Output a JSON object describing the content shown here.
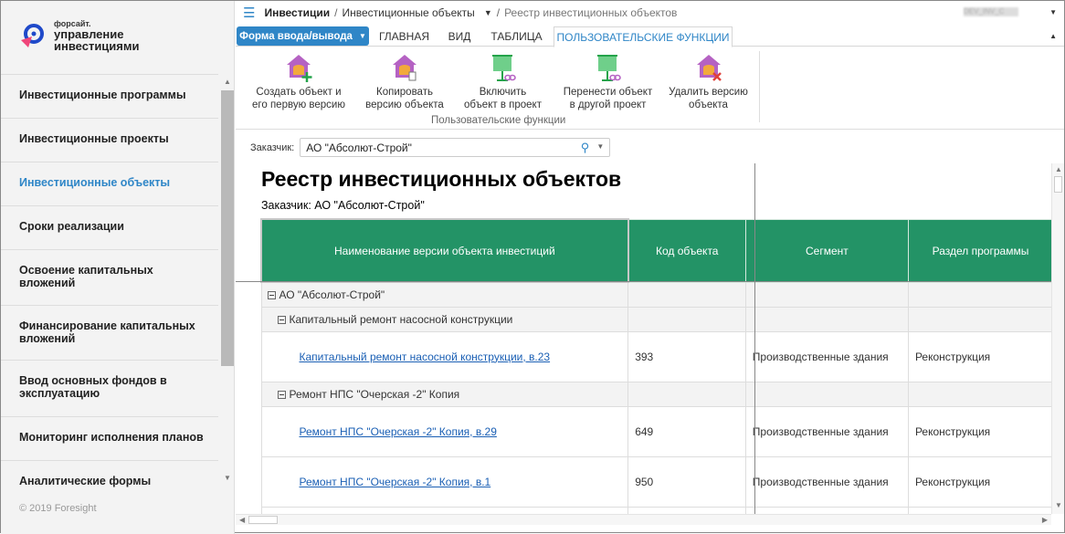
{
  "brand": {
    "company": "форсайт.",
    "product_line1": "управление",
    "product_line2": "инвестициями"
  },
  "sidebar": {
    "items": [
      {
        "label": "Инвестиционные программы"
      },
      {
        "label": "Инвестиционные проекты"
      },
      {
        "label": "Инвестиционные объекты",
        "active": true
      },
      {
        "label": "Сроки реализации"
      },
      {
        "label": "Освоение капитальных вложений"
      },
      {
        "label": "Финансирование капитальных вложений"
      },
      {
        "label": "Ввод основных фондов в эксплуатацию"
      },
      {
        "label": "Мониторинг исполнения планов"
      },
      {
        "label": "Аналитические формы"
      }
    ],
    "footer": "© 2019 Foresight"
  },
  "breadcrumb": {
    "root": "Инвестиции",
    "section": "Инвестиционные объекты",
    "page": "Реестр инвестиционных объектов"
  },
  "user": "DEV_INV_C",
  "tabs": {
    "form_button": "Форма ввода/вывода",
    "items": [
      "ГЛАВНАЯ",
      "ВИД",
      "ТАБЛИЦА",
      "ПОЛЬЗОВАТЕЛЬСКИЕ ФУНКЦИИ"
    ]
  },
  "ribbon": {
    "group_label": "Пользовательские функции",
    "buttons": [
      {
        "l1": "Создать объект и",
        "l2": "его первую версию"
      },
      {
        "l1": "Копировать",
        "l2": "версию объекта"
      },
      {
        "l1": "Включить",
        "l2": "объект в проект"
      },
      {
        "l1": "Перенести объект",
        "l2": "в другой проект"
      },
      {
        "l1": "Удалить версию",
        "l2": "объекта"
      }
    ]
  },
  "filter": {
    "label": "Заказчик:",
    "value": "АО \"Абсолют-Строй\""
  },
  "report": {
    "title": "Реестр инвестиционных объектов",
    "subtitle": "Заказчик: АО \"Абсолют-Строй\"",
    "columns": [
      "Наименование версии объекта инвестиций",
      "Код объекта",
      "Сегмент",
      "Раздел программы"
    ],
    "rows": [
      {
        "name": "АО \"Абсолют-Строй\""
      },
      {
        "name": "Капитальный ремонт насосной конструкции"
      },
      {
        "name": "Капитальный ремонт насосной конструкции, в.23",
        "code": "393",
        "segment": "Производственные здания",
        "section": "Реконструкция"
      },
      {
        "name": "Ремонт НПС \"Очерская -2\" Копия"
      },
      {
        "name": "Ремонт НПС \"Очерская -2\" Копия, в.29",
        "code": "649",
        "segment": "Производственные здания",
        "section": "Реконструкция"
      },
      {
        "name": "Ремонт НПС \"Очерская -2\" Копия, в.1",
        "code": "950",
        "segment": "Производственные здания",
        "section": "Реконструкция"
      }
    ]
  }
}
